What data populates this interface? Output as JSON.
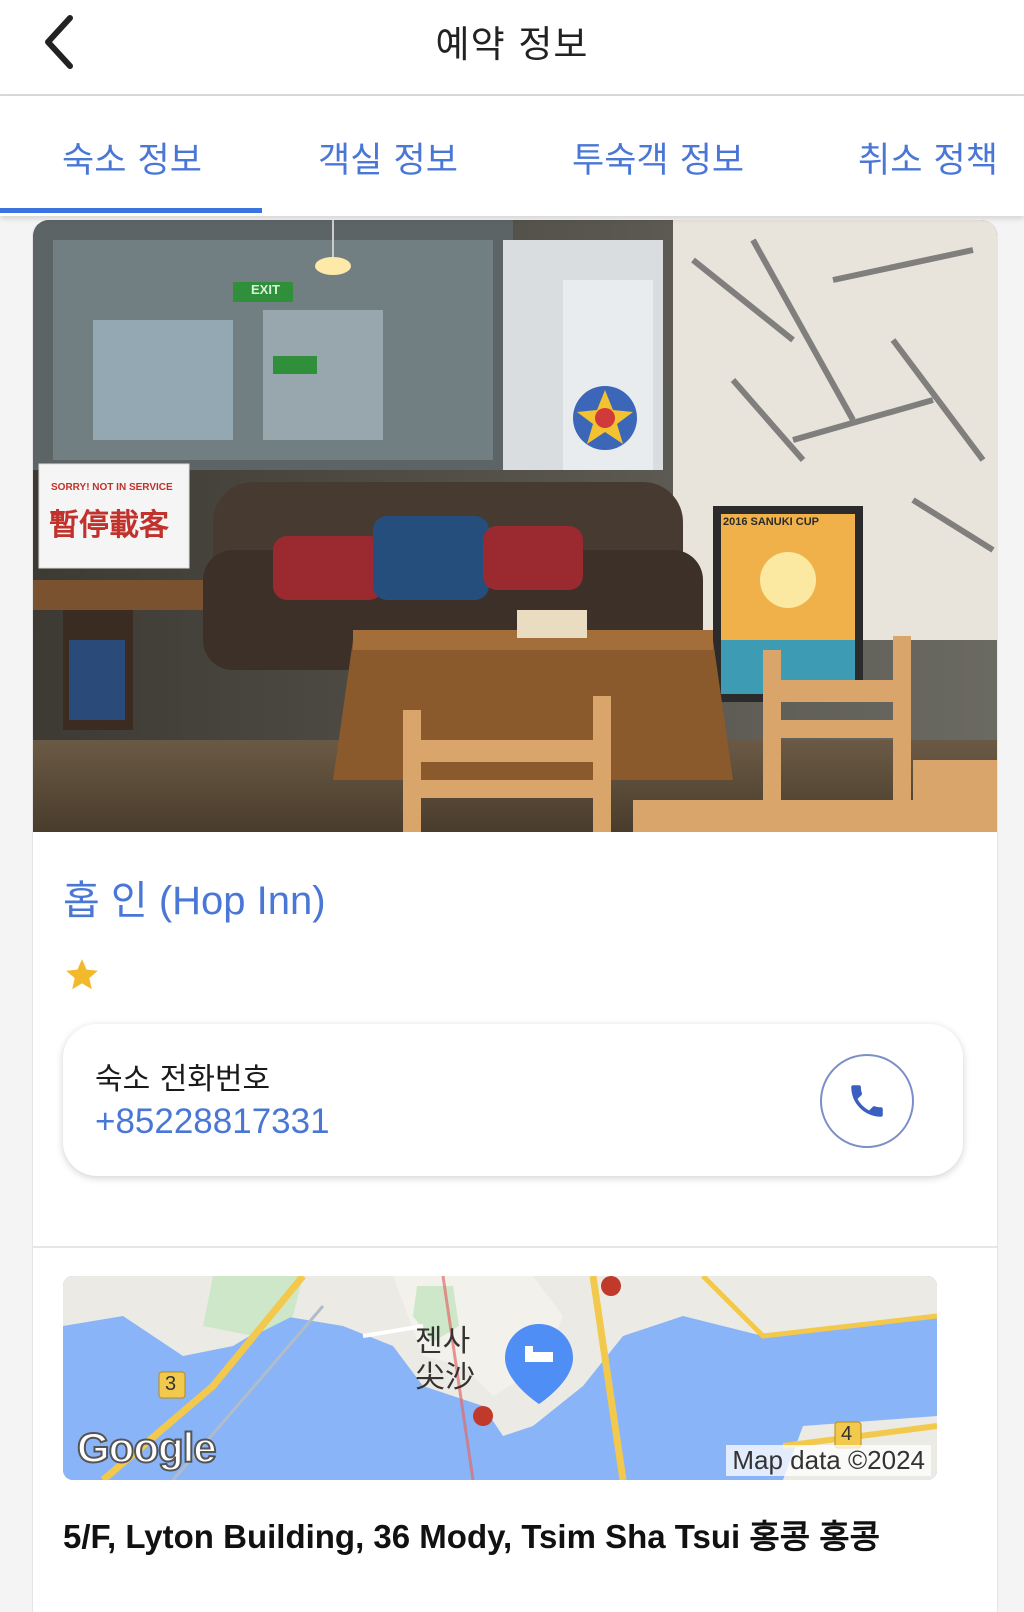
{
  "header": {
    "title": "예약 정보",
    "back_icon": "chevron-left-icon"
  },
  "tabs": [
    {
      "label": "숙소 정보",
      "active": true
    },
    {
      "label": "객실 정보",
      "active": false
    },
    {
      "label": "투숙객 정보",
      "active": false
    },
    {
      "label": "취소 정책",
      "active": false
    }
  ],
  "hotel": {
    "name": "홉 인 (Hop Inn)",
    "star_rating": 1,
    "photo_signs": {
      "sign_top": "SORRY! NOT IN SERVICE",
      "sign_main": "暫停載客",
      "exit_sign": "EXIT",
      "poster": "2016 SANUKI CUP"
    }
  },
  "phone": {
    "label": "숙소 전화번호",
    "number": "+85228817331",
    "icon": "phone-icon"
  },
  "map": {
    "label_kr": "젠사",
    "label_cn": "尖沙",
    "route_a": "3",
    "route_b": "4",
    "logo": "Google",
    "attribution": "Map data ©2024",
    "pin_icon": "bed-icon"
  },
  "address": "5/F, Lyton Building, 36 Mody, Tsim Sha Tsui 홍콩 홍콩",
  "colors": {
    "accent": "#4a77d6",
    "indicator": "#3b73e0",
    "star": "#f2b92c"
  }
}
